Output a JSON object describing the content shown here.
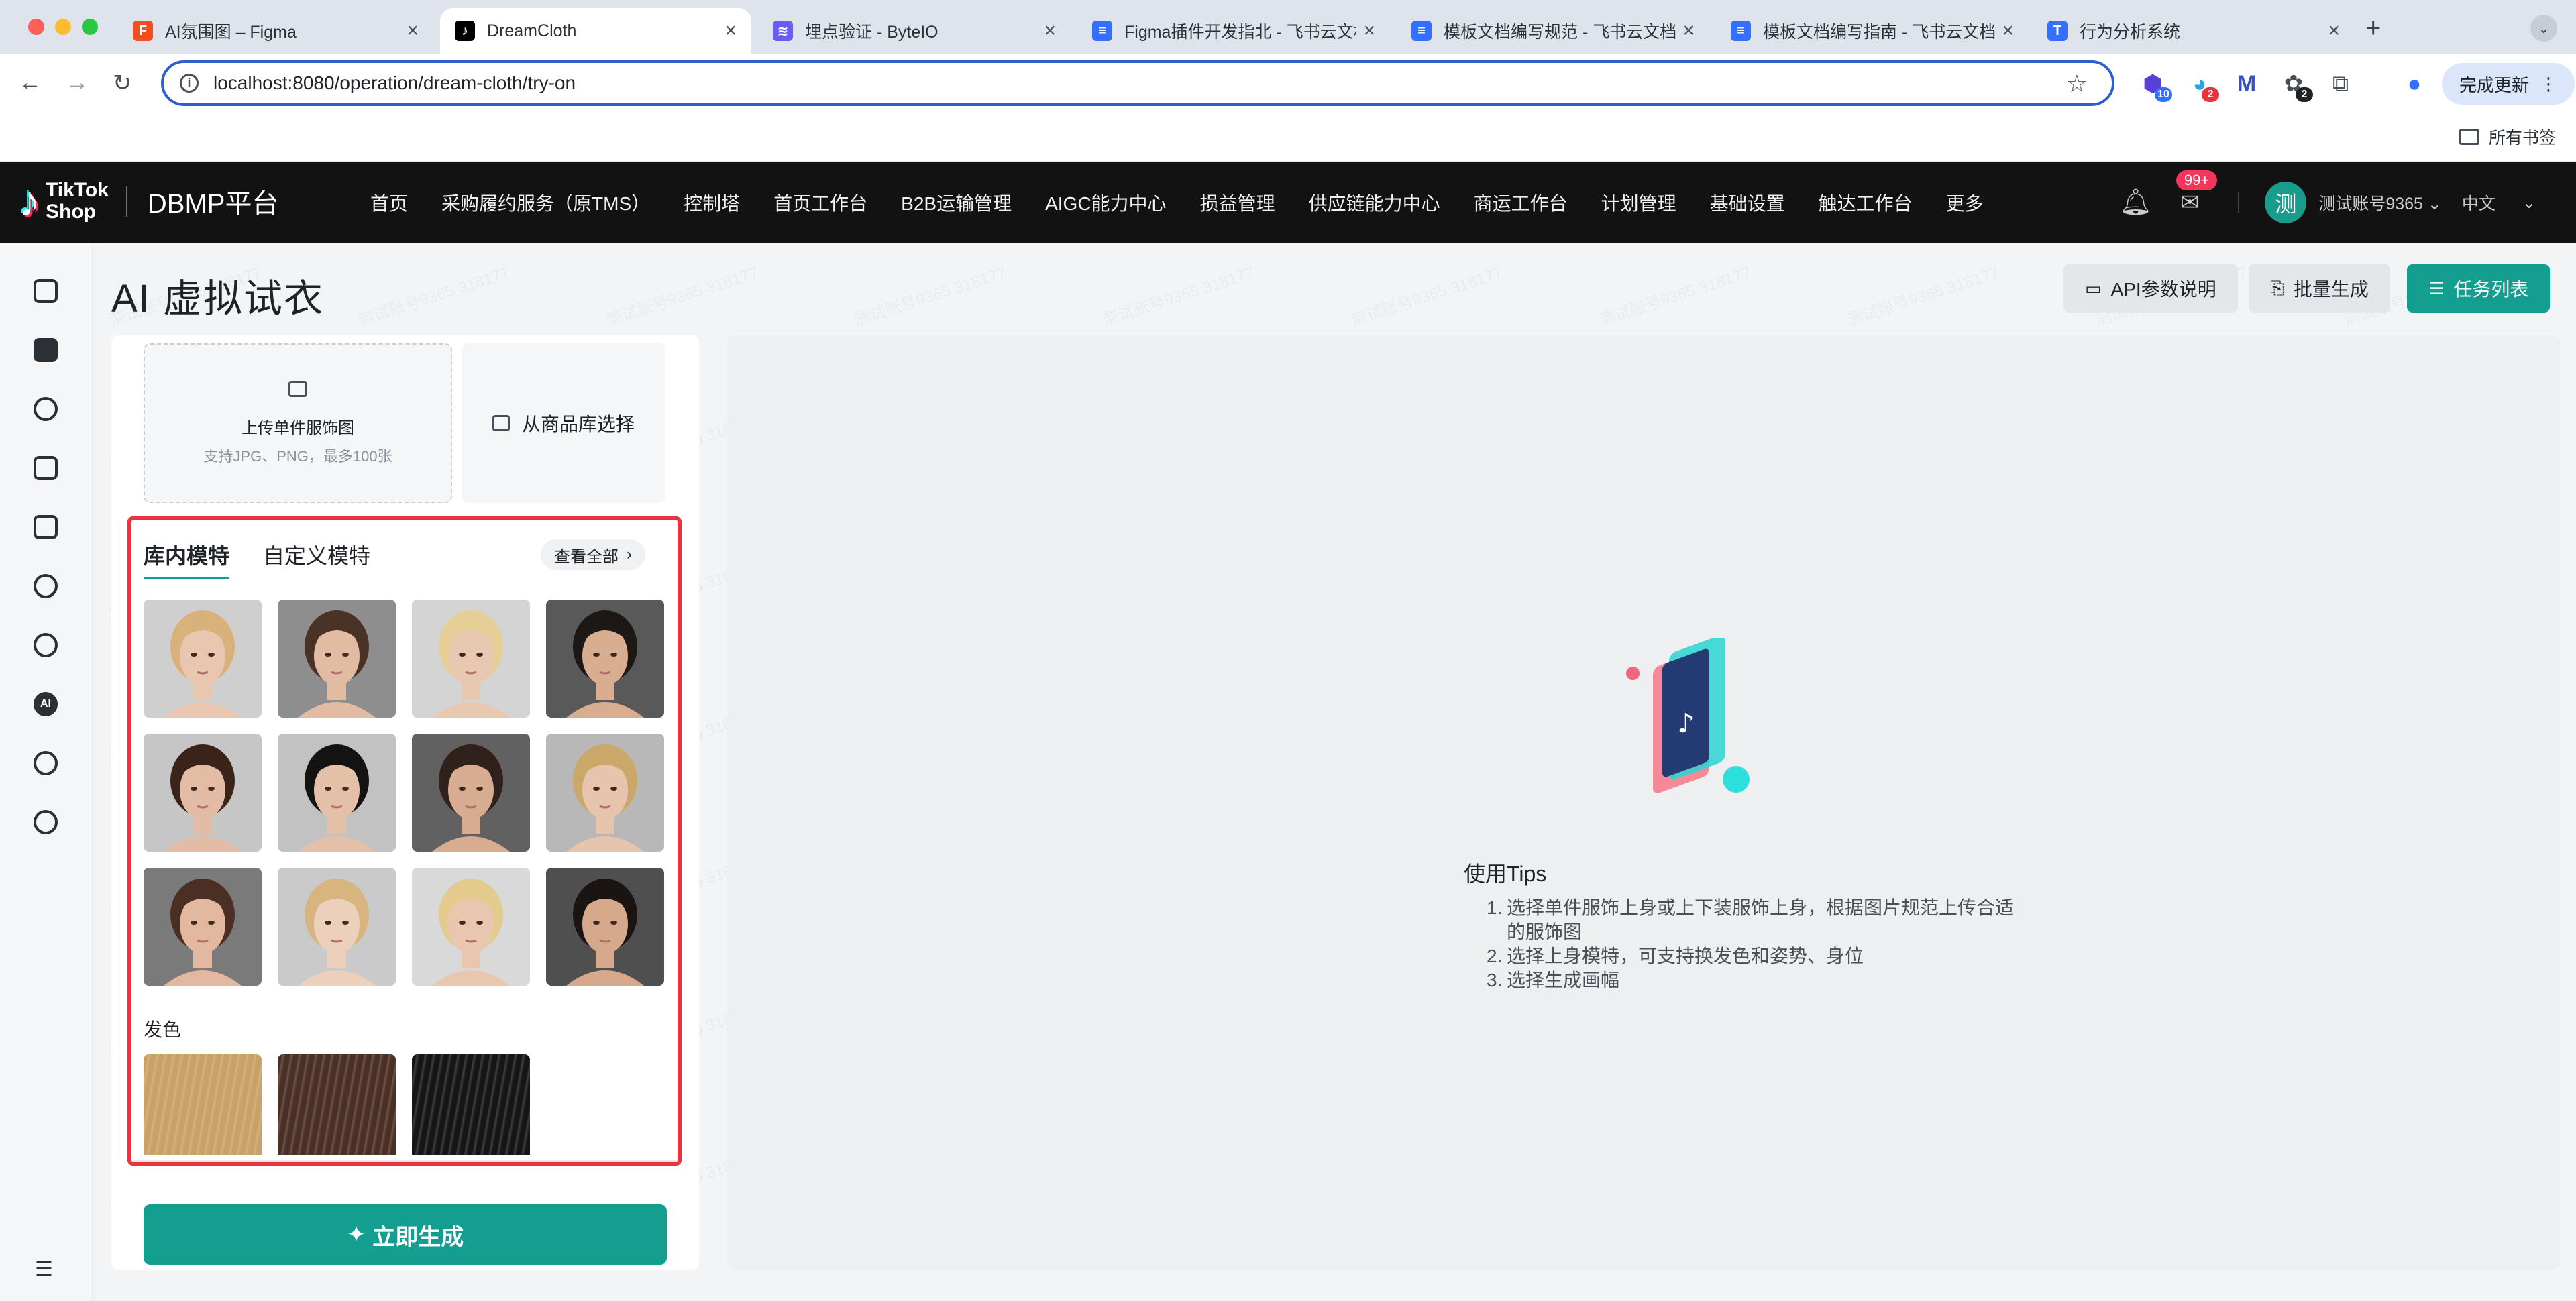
{
  "browser": {
    "tabs": [
      {
        "title": "AI氛围图 – Figma",
        "favicon": "figma",
        "color": "#f24e1e"
      },
      {
        "title": "DreamCloth",
        "favicon": "tiktok",
        "color": "#000000",
        "active": true
      },
      {
        "title": "埋点验证 - ByteIO",
        "favicon": "byteio",
        "color": "#6b5cf6"
      },
      {
        "title": "Figma插件开发指北 - 飞书云文档",
        "favicon": "doc",
        "color": "#3370ff"
      },
      {
        "title": "模板文档编写规范 - 飞书云文档",
        "favicon": "doc",
        "color": "#3370ff"
      },
      {
        "title": "模板文档编写指南 - 飞书云文档",
        "favicon": "doc",
        "color": "#3370ff"
      },
      {
        "title": "行为分析系统",
        "favicon": "T",
        "color": "#3370ff"
      }
    ],
    "url": "localhost:8080/operation/dream-cloth/try-on",
    "extensions": [
      {
        "name": "ext-1",
        "badge": "10",
        "badge_color": "#3370ff"
      },
      {
        "name": "ext-2",
        "badge": "2",
        "badge_color": "#e8343d"
      },
      {
        "name": "ext-m"
      },
      {
        "name": "ext-3",
        "badge": "2",
        "badge_color": "#1f2329"
      },
      {
        "name": "puzzle-icon"
      }
    ],
    "update_label": "完成更新",
    "bookmarks_label": "所有书签"
  },
  "header": {
    "brand_top": "TikTok",
    "brand_bottom": "Shop",
    "platform": "DBMP平台",
    "menu": [
      "首页",
      "采购履约服务（原TMS）",
      "控制塔",
      "首页工作台",
      "B2B运输管理",
      "AIGC能力中心",
      "损益管理",
      "供应链能力中心",
      "商运工作台",
      "计划管理",
      "基础设置",
      "触达工作台",
      "更多"
    ],
    "badge": "99+",
    "avatar_char": "测",
    "account": "测试账号9365",
    "language": "中文"
  },
  "page": {
    "title": "AI 虚拟试衣",
    "buttons": {
      "api_doc": "API参数说明",
      "batch": "批量生成",
      "tasks": "任务列表"
    }
  },
  "left": {
    "upload_title": "上传单件服饰图",
    "upload_hint": "支持JPG、PNG，最多100张",
    "library": "从商品库选择",
    "tabs": [
      "库内模特",
      "自定义模特"
    ],
    "view_all": "查看全部",
    "models": [
      {
        "name": "model-1",
        "skin": "#e8c6b0",
        "hair": "#d8b27a",
        "bg": "#cfcfcf"
      },
      {
        "name": "model-2",
        "skin": "#e2bba3",
        "hair": "#4a3226",
        "bg": "#8e8e8e"
      },
      {
        "name": "model-3",
        "skin": "#e9c8b2",
        "hair": "#e6cf96",
        "bg": "#d4d4d4"
      },
      {
        "name": "model-4",
        "skin": "#d9ad90",
        "hair": "#1d1815",
        "bg": "#595959"
      },
      {
        "name": "model-5",
        "skin": "#e3bca5",
        "hair": "#3a2419",
        "bg": "#c6c6c6"
      },
      {
        "name": "model-6",
        "skin": "#e4c0a8",
        "hair": "#151312",
        "bg": "#c2c2c2"
      },
      {
        "name": "model-7",
        "skin": "#d8ac90",
        "hair": "#2e221b",
        "bg": "#616161"
      },
      {
        "name": "model-8",
        "skin": "#e6c4ad",
        "hair": "#c9a86a",
        "bg": "#b8b8b8"
      },
      {
        "name": "model-9",
        "skin": "#e2b9a0",
        "hair": "#4c2f24",
        "bg": "#7a7a7a"
      },
      {
        "name": "model-10",
        "skin": "#ecd0bb",
        "hair": "#d8b57e",
        "bg": "#cacaca"
      },
      {
        "name": "model-11",
        "skin": "#e8c6b0",
        "hair": "#e3cb8d",
        "bg": "#d9d9d9"
      },
      {
        "name": "model-12",
        "skin": "#d6a98c",
        "hair": "#1a1512",
        "bg": "#4f4f4f"
      }
    ],
    "hair_title": "发色",
    "hair_colors": [
      "#c9a066",
      "#4a2f22",
      "#151515"
    ],
    "generate": "立即生成"
  },
  "tips": {
    "title": "使用Tips",
    "items": [
      "选择单件服饰上身或上下装服饰上身，根据图片规范上传合适的服饰图",
      "选择上身模特，可支持换发色和姿势、身位",
      "选择生成画幅"
    ]
  },
  "watermark": "测试账号9365 318177"
}
